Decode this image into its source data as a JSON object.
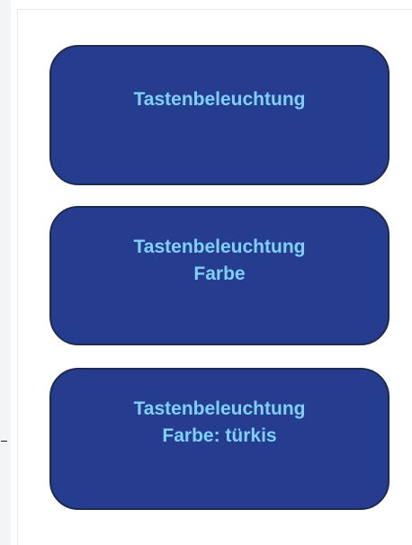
{
  "tiles": [
    {
      "line1": "Tastenbeleuchtung",
      "line2": ""
    },
    {
      "line1": "Tastenbeleuchtung",
      "line2": "Farbe"
    },
    {
      "line1": "Tastenbeleuchtung",
      "line2": "Farbe: türkis"
    }
  ],
  "colors": {
    "tile_background": "#263d8f",
    "tile_border": "#1f2a4f",
    "tile_text": "#7fd0ff"
  }
}
